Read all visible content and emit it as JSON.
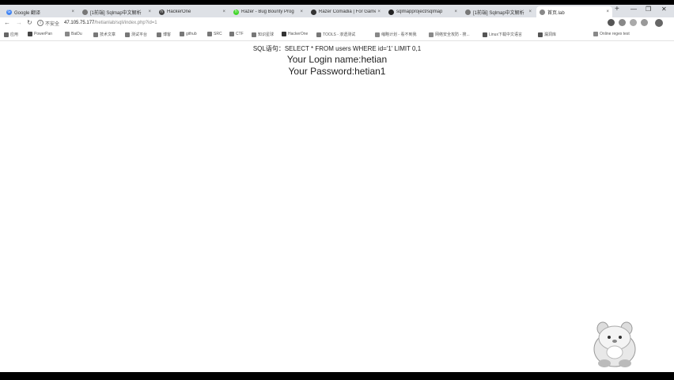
{
  "tabs": [
    {
      "title": "Google 翻译",
      "active": false,
      "color": "#4285f4"
    },
    {
      "title": "[1前端] Sqlmap中文解析",
      "active": false,
      "color": "#777777"
    },
    {
      "title": "HackerOne",
      "active": false,
      "color": "#444444"
    },
    {
      "title": "Razer - Bug Bounty Prog",
      "active": false,
      "color": "#44d62c"
    },
    {
      "title": "Razer Comadia | For Gamers",
      "active": false,
      "color": "#333333"
    },
    {
      "title": "sqlmapproject/sqlmap",
      "active": false,
      "color": "#222222"
    },
    {
      "title": "[1前端] Sqlmap中文解析",
      "active": false,
      "color": "#777777"
    },
    {
      "title": "首页.lab",
      "active": true,
      "color": "#888888"
    }
  ],
  "address": {
    "security": "不安全",
    "host": "47.105.75.177",
    "path": "/hetianlab/sqli/index.php?id=1"
  },
  "bookmarks": [
    "应用",
    "PowerPan",
    "BaiDu",
    "技术文章",
    "测试平台",
    "博客",
    "github",
    "SRC",
    "CTF",
    "知识星球",
    "HackerOne",
    "TOOLS - 渗透测试",
    "缩略计划 - 看不到我",
    "网络安全攻防 - 搜...",
    "Linux下载中文语言",
    "漏洞库",
    "Online regex test"
  ],
  "content": {
    "sql": "SQL语句：SELECT * FROM users WHERE id='1' LIMIT 0,1",
    "login": "Your Login name:hetian",
    "password": "Your Password:hetian1"
  }
}
